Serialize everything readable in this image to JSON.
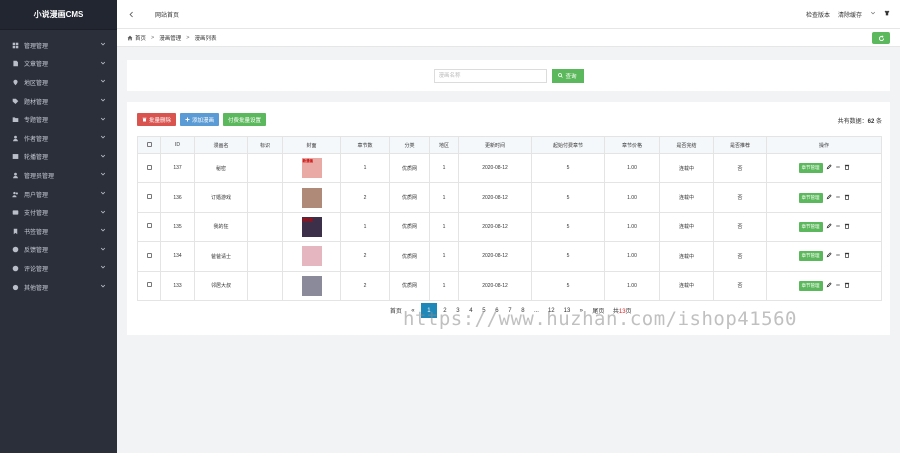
{
  "brand": "小说漫画CMS",
  "sidebar": {
    "items": [
      {
        "label": "管理管理",
        "icon": "grid-icon"
      },
      {
        "label": "文章管理",
        "icon": "document-icon"
      },
      {
        "label": "地区管理",
        "icon": "map-icon"
      },
      {
        "label": "题材管理",
        "icon": "tag-icon"
      },
      {
        "label": "专题管理",
        "icon": "folder-icon"
      },
      {
        "label": "作者管理",
        "icon": "user-icon"
      },
      {
        "label": "轮播管理",
        "icon": "image-icon"
      },
      {
        "label": "管理员管理",
        "icon": "admin-icon"
      },
      {
        "label": "用户管理",
        "icon": "users-icon"
      },
      {
        "label": "支付管理",
        "icon": "card-icon"
      },
      {
        "label": "书签管理",
        "icon": "bookmark-icon"
      },
      {
        "label": "反馈管理",
        "icon": "feedback-icon"
      },
      {
        "label": "评论管理",
        "icon": "comment-icon"
      },
      {
        "label": "其他管理",
        "icon": "gear-icon"
      }
    ]
  },
  "topbar": {
    "tab_label": "网站首页",
    "check_version": "检查版本",
    "clear_cache": "清除缓存"
  },
  "breadcrumb": {
    "home": "首页",
    "level2": "漫画管理",
    "level3": "漫画列表"
  },
  "search": {
    "placeholder": "漫画名称",
    "button": "查询"
  },
  "actions": {
    "batch_delete": "批量删除",
    "add_comic": "添加漫画",
    "pay_settings": "付费批量设置"
  },
  "total": {
    "prefix": "共有数据：",
    "count": "62",
    "suffix": " 条"
  },
  "table": {
    "headers": [
      "",
      "ID",
      "漫画名",
      "标识",
      "封面",
      "章节数",
      "分类",
      "地区",
      "更新时间",
      "起始付费章节",
      "章节价格",
      "是否完结",
      "是否推荐",
      "操作"
    ],
    "rows": [
      {
        "id": "137",
        "name": "秘密",
        "tag": "",
        "chapters": "1",
        "category": "优质网",
        "region": "1",
        "updated": "2020-08-12",
        "pay_start": "5",
        "price": "1.00",
        "finished": "连载中",
        "recommend": "否",
        "cover_color": "#e9a9a4",
        "cover_tag": "新漫画"
      },
      {
        "id": "136",
        "name": "订婚游戏",
        "tag": "",
        "chapters": "2",
        "category": "优质网",
        "region": "1",
        "updated": "2020-08-12",
        "pay_start": "5",
        "price": "1.00",
        "finished": "连载中",
        "recommend": "否",
        "cover_color": "#b08a78",
        "cover_tag": ""
      },
      {
        "id": "135",
        "name": "我的狂",
        "tag": "",
        "chapters": "1",
        "category": "优质网",
        "region": "1",
        "updated": "2020-08-12",
        "pay_start": "5",
        "price": "1.00",
        "finished": "连载中",
        "recommend": "否",
        "cover_color": "#3c2f4a",
        "cover_tag": "我的狂"
      },
      {
        "id": "134",
        "name": "爸爸请士",
        "tag": "",
        "chapters": "2",
        "category": "优质网",
        "region": "1",
        "updated": "2020-08-12",
        "pay_start": "5",
        "price": "1.00",
        "finished": "连载中",
        "recommend": "否",
        "cover_color": "#e6b6c0",
        "cover_tag": ""
      },
      {
        "id": "133",
        "name": "邻居大叔",
        "tag": "",
        "chapters": "2",
        "category": "优质网",
        "region": "1",
        "updated": "2020-08-12",
        "pay_start": "5",
        "price": "1.00",
        "finished": "连载中",
        "recommend": "否",
        "cover_color": "#8a8a9a",
        "cover_tag": ""
      }
    ],
    "op_label": "章节管理"
  },
  "pagination": {
    "first": "首页",
    "prev": "«",
    "pages": [
      "1",
      "2",
      "3",
      "4",
      "5",
      "6",
      "7",
      "8",
      "...",
      "12",
      "13"
    ],
    "active": "1",
    "next": "»",
    "last": "尾页",
    "total_prefix": "共",
    "total_pages": "13",
    "total_suffix": "页"
  },
  "watermark": "https://www.huzhan.com/ishop41560"
}
